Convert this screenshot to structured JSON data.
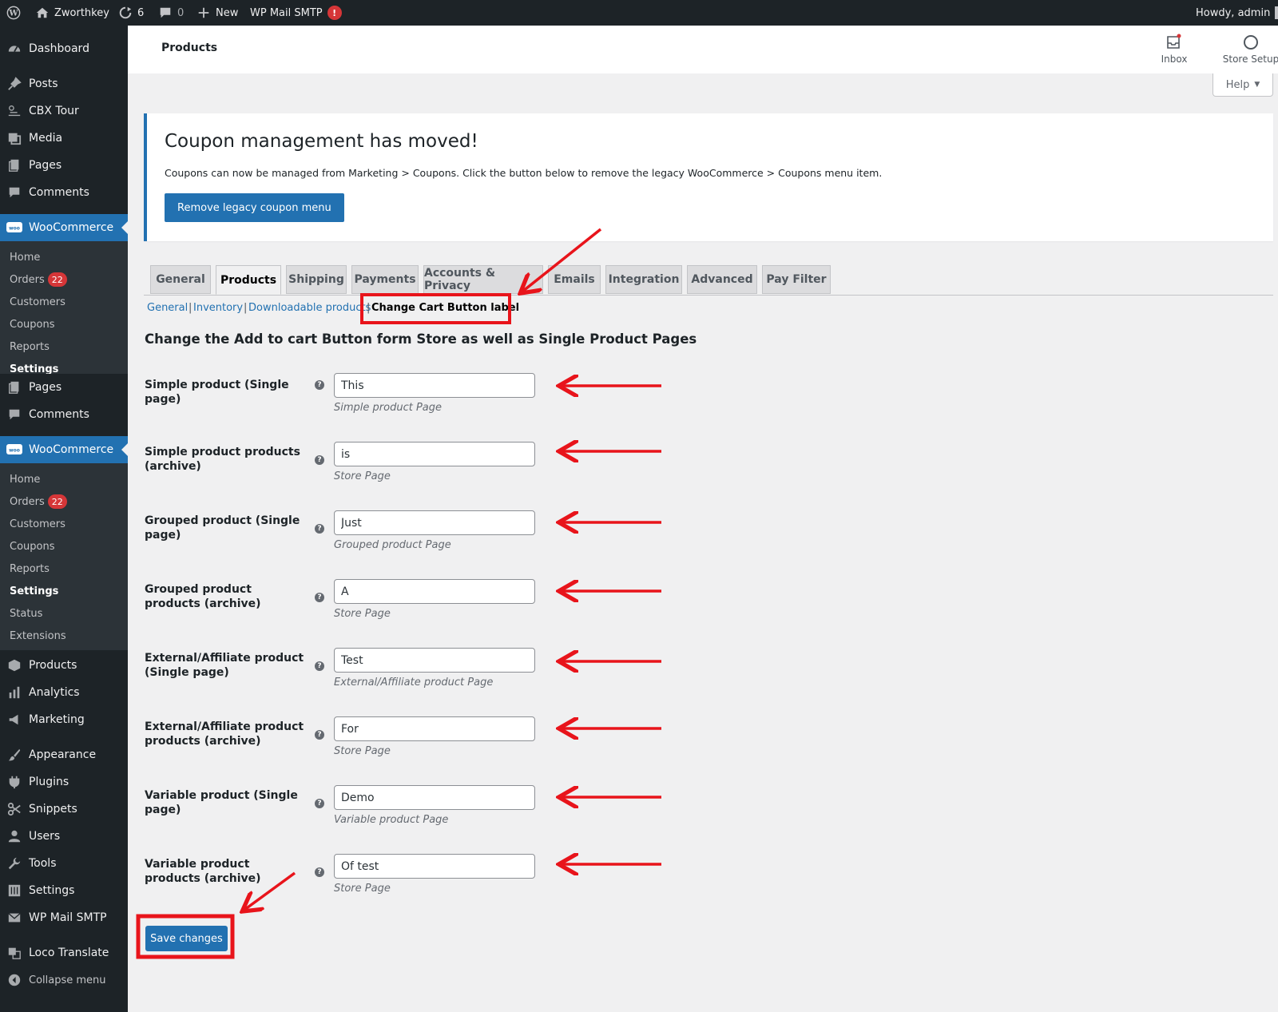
{
  "adminbar": {
    "site_name": "Zworthkey",
    "updates_count": "6",
    "comments_count": "0",
    "new_label": "New",
    "smtp_label": "WP Mail SMTP",
    "smtp_alert": "!",
    "howdy": "Howdy, admin"
  },
  "sidebar": {
    "top_items": [
      "Dashboard",
      "Posts",
      "CBX Tour",
      "Media",
      "Pages",
      "Comments",
      "WooCommerce"
    ],
    "woo_sub_1": [
      "Home",
      "Orders",
      "Customers",
      "Coupons",
      "Reports",
      "Settings"
    ],
    "mid_items": [
      "Pages",
      "Comments",
      "WooCommerce"
    ],
    "woo_sub_2": [
      "Home",
      "Orders",
      "Customers",
      "Coupons",
      "Reports",
      "Settings",
      "Status",
      "Extensions"
    ],
    "bottom_items": [
      "Products",
      "Analytics",
      "Marketing",
      "Appearance",
      "Plugins",
      "Snippets",
      "Users",
      "Tools",
      "Settings",
      "WP Mail SMTP",
      "Loco Translate"
    ],
    "orders_badge": "22",
    "collapse_label": "Collapse menu"
  },
  "header": {
    "title": "Products",
    "inbox_label": "Inbox",
    "store_setup_label": "Store Setup",
    "help_label": "Help"
  },
  "notice": {
    "title": "Coupon management has moved!",
    "text": "Coupons can now be managed from Marketing > Coupons. Click the button below to remove the legacy WooCommerce > Coupons menu item.",
    "button_label": "Remove legacy coupon menu"
  },
  "tabs": [
    "General",
    "Products",
    "Shipping",
    "Payments",
    "Accounts & Privacy",
    "Emails",
    "Integration",
    "Advanced",
    "Pay Filter"
  ],
  "subsections": [
    "General",
    "Inventory",
    "Downloadable products",
    "Change Cart Button label"
  ],
  "section_title": "Change the Add to cart Button form Store as well as Single Product Pages",
  "fields": [
    {
      "label": "Simple product (Single page)",
      "value": "This",
      "desc": "Simple product Page"
    },
    {
      "label": "Simple product products (archive)",
      "value": "is",
      "desc": "Store Page"
    },
    {
      "label": "Grouped product (Single page)",
      "value": "Just",
      "desc": "Grouped product Page"
    },
    {
      "label": "Grouped product products (archive)",
      "value": "A",
      "desc": "Store Page"
    },
    {
      "label": "External/Affiliate product (Single page)",
      "value": "Test",
      "desc": "External/Affiliate product Page"
    },
    {
      "label": "External/Affiliate product products (archive)",
      "value": "For",
      "desc": "Store Page"
    },
    {
      "label": "Variable product (Single page)",
      "value": "Demo",
      "desc": "Variable product Page"
    },
    {
      "label": "Variable product products (archive)",
      "value": "Of test",
      "desc": "Store Page"
    }
  ],
  "save_label": "Save changes",
  "colors": {
    "admin_dark": "#1d2327",
    "accent_blue": "#2271b1",
    "annotation_red": "#e8141b",
    "badge_red": "#d63638"
  }
}
